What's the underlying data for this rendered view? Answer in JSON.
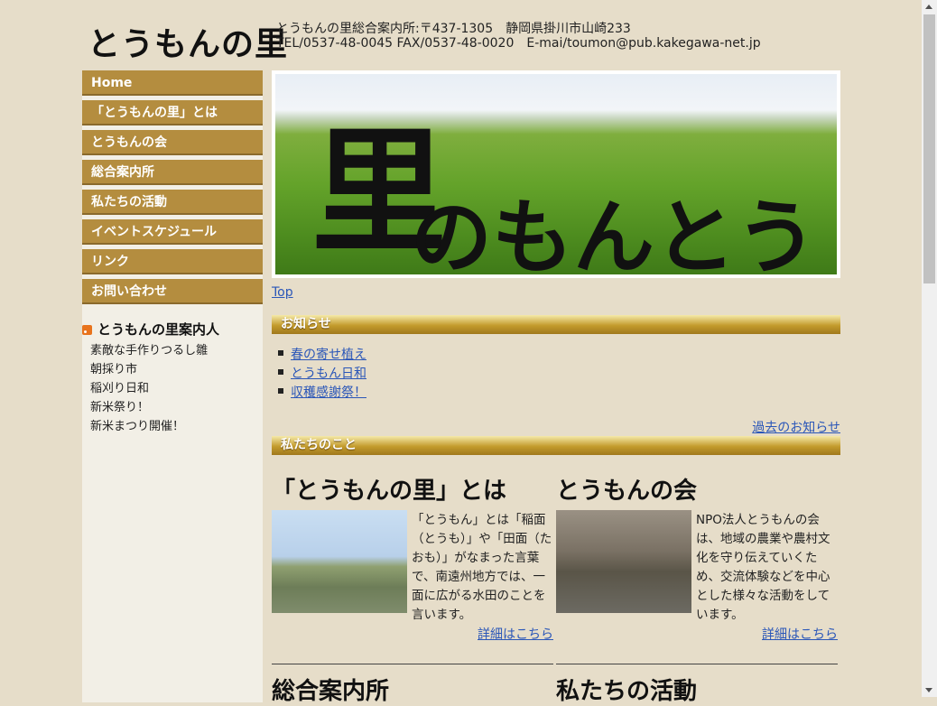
{
  "header": {
    "logo": "とうもんの里",
    "address_line1": "とうもんの里総合案内所:〒437-1305　静岡県掛川市山崎233",
    "address_line2": "TEL/0537-48-0045 FAX/0537-48-0020　E-mai/toumon@pub.kakegawa-net.jp"
  },
  "nav": [
    "Home",
    "「とうもんの里」とは",
    "とうもんの会",
    "総合案内所",
    "私たちの活動",
    "イベントスケジュール",
    "リンク",
    "お問い合わせ"
  ],
  "feed": {
    "title": "とうもんの里案内人",
    "items": [
      "素敵な手作りつるし雛",
      "朝採り市",
      "稲刈り日和",
      "新米祭り！",
      "新米まつり開催！"
    ]
  },
  "hero": {
    "big": "里",
    "small": "のもんとう"
  },
  "top_link": "Top",
  "news": {
    "heading": "お知らせ",
    "items": [
      "春の寄せ植え",
      "とうもん日和",
      "収穫感謝祭！"
    ],
    "past_link": "過去のお知らせ"
  },
  "about": {
    "heading": "私たちのこと",
    "left": {
      "title": "「とうもんの里」とは",
      "text": "「とうもん」とは「稲面（とうも）」や「田面（たおも）」がなまった言葉で、南遠州地方では、一面に広がる水田のことを言います。",
      "more": "詳細はこちら"
    },
    "right": {
      "title": "とうもんの会",
      "text": "NPO法人とうもんの会は、地域の農業や農村文化を守り伝えていくため、交流体験などを中心とした様々な活動をしています。",
      "more": "詳細はこちら"
    },
    "bottom_left_title": "総合案内所",
    "bottom_right_title": "私たちの活動"
  }
}
